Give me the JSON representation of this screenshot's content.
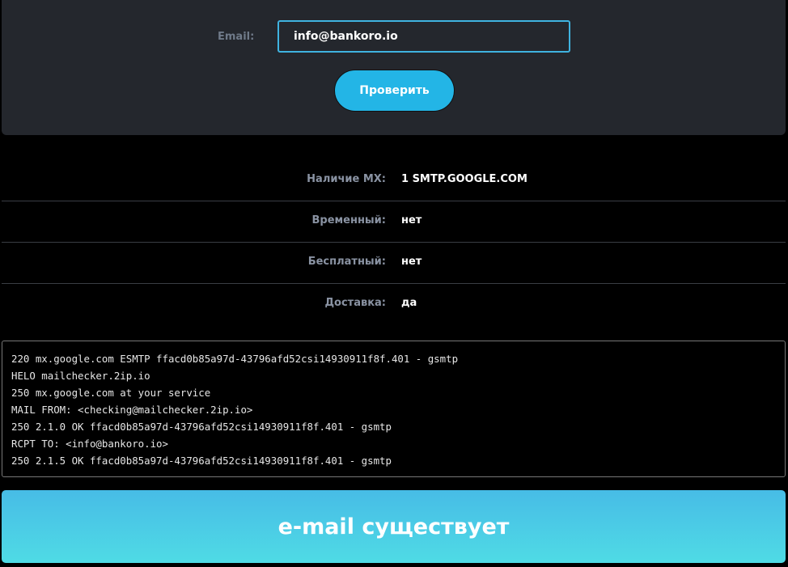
{
  "form": {
    "email_label": "Email:",
    "email_value": "info@bankoro.io",
    "check_button": "Проверить"
  },
  "results": [
    {
      "label": "Наличие MX:",
      "value": "1 SMTP.GOOGLE.COM"
    },
    {
      "label": "Временный:",
      "value": "нет"
    },
    {
      "label": "Бесплатный:",
      "value": "нет"
    },
    {
      "label": "Доставка:",
      "value": "да"
    }
  ],
  "log": [
    "220 mx.google.com ESMTP ffacd0b85a97d-43796afd52csi14930911f8f.401 - gsmtp",
    "HELO mailchecker.2ip.io",
    "250 mx.google.com at your service",
    "MAIL FROM: <checking@mailchecker.2ip.io>",
    "250 2.1.0 OK ffacd0b85a97d-43796afd52csi14930911f8f.401 - gsmtp",
    "RCPT TO: <info@bankoro.io>",
    "250 2.1.5 OK ffacd0b85a97d-43796afd52csi14930911f8f.401 - gsmtp"
  ],
  "verdict": "e-mail существует"
}
